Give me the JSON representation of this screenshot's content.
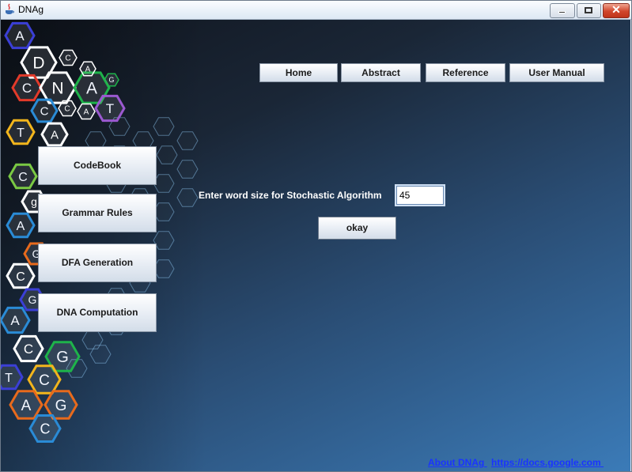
{
  "window": {
    "title": "DNAg",
    "close_glyph": "✕"
  },
  "logo": {
    "icon": "dna-hexagon-logo",
    "letters": [
      "A",
      "D",
      "C",
      "N",
      "A",
      "C",
      "T",
      "A",
      "C",
      "g",
      "A",
      "G",
      "C",
      "G",
      "A",
      "C",
      "G",
      "T",
      "C",
      "A",
      "G",
      "C",
      "C",
      "A",
      "G",
      "T",
      "A",
      "C",
      "T",
      "A"
    ]
  },
  "nav": {
    "home": "Home",
    "abstract": "Abstract",
    "reference": "Reference",
    "user_manual": "User Manual"
  },
  "sidebar": {
    "codebook": "CodeBook",
    "grammar_rules": "Grammar Rules",
    "dfa_generation": "DFA Generation",
    "dna_computation": "DNA Computation"
  },
  "form": {
    "prompt": "Enter word size for Stochastic Algorithm",
    "word_size_value": "45",
    "okay_label": "okay"
  },
  "footer": {
    "about_link": "About DNAg ",
    "docs_link": "https://docs.google.com "
  },
  "colors": {
    "link": "#1a34ff",
    "hex_palette": [
      "#3b3fd6",
      "#e23a2a",
      "#f2b51c",
      "#2a8bd6",
      "#7ac943",
      "#e86a1c",
      "#ffffff",
      "#9b59d0",
      "#1eb34a"
    ]
  }
}
